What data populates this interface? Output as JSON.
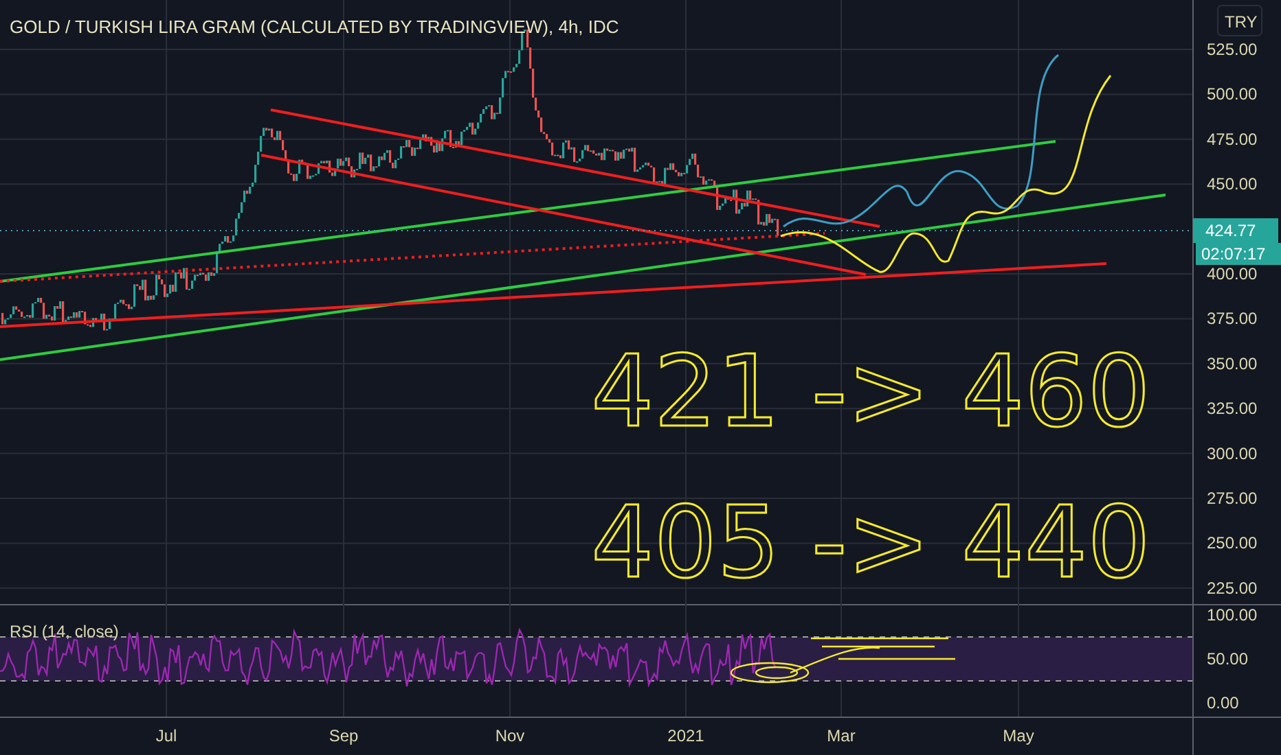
{
  "title": "GOLD / TURKISH LIRA GRAM (CALCULATED BY TRADINGVIEW), 4h, IDC",
  "price_axis": {
    "currency": "TRY",
    "ticks": [
      "525.00",
      "500.00",
      "475.00",
      "450.00",
      "400.00",
      "375.00",
      "350.00",
      "325.00",
      "300.00",
      "275.00",
      "250.00",
      "225.00"
    ],
    "last_price": "424.77",
    "countdown": "02:07:17"
  },
  "annotations": [
    "421 -> 460",
    "405 -> 440"
  ],
  "rsi": {
    "label": "RSI (14, close)",
    "ticks": [
      "100.00",
      "50.00",
      "0.00"
    ]
  },
  "time_axis": {
    "ticks": [
      "Jul",
      "Sep",
      "Nov",
      "2021",
      "Mar",
      "May"
    ]
  }
}
